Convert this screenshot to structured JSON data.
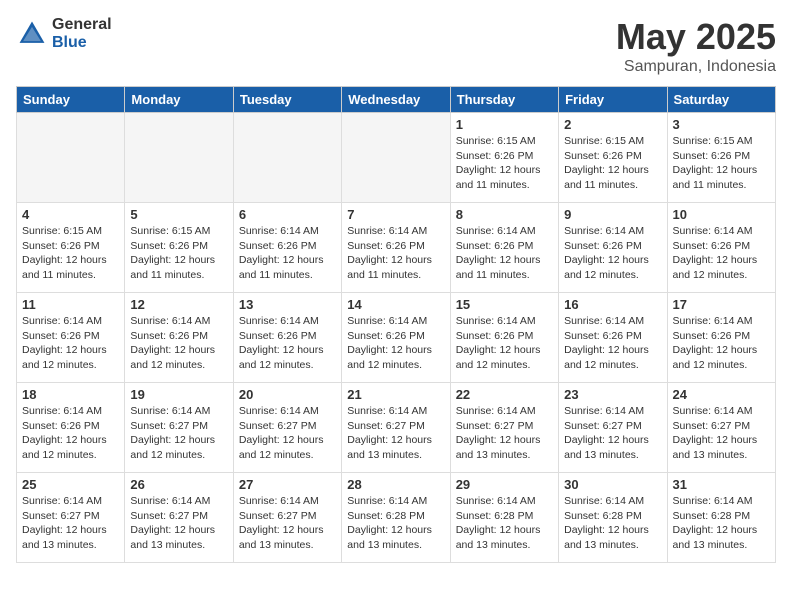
{
  "header": {
    "logo_general": "General",
    "logo_blue": "Blue",
    "title": "May 2025",
    "subtitle": "Sampuran, Indonesia"
  },
  "days_of_week": [
    "Sunday",
    "Monday",
    "Tuesday",
    "Wednesday",
    "Thursday",
    "Friday",
    "Saturday"
  ],
  "weeks": [
    [
      {
        "day": "",
        "info": ""
      },
      {
        "day": "",
        "info": ""
      },
      {
        "day": "",
        "info": ""
      },
      {
        "day": "",
        "info": ""
      },
      {
        "day": "1",
        "info": "Sunrise: 6:15 AM\nSunset: 6:26 PM\nDaylight: 12 hours\nand 11 minutes."
      },
      {
        "day": "2",
        "info": "Sunrise: 6:15 AM\nSunset: 6:26 PM\nDaylight: 12 hours\nand 11 minutes."
      },
      {
        "day": "3",
        "info": "Sunrise: 6:15 AM\nSunset: 6:26 PM\nDaylight: 12 hours\nand 11 minutes."
      }
    ],
    [
      {
        "day": "4",
        "info": "Sunrise: 6:15 AM\nSunset: 6:26 PM\nDaylight: 12 hours\nand 11 minutes."
      },
      {
        "day": "5",
        "info": "Sunrise: 6:15 AM\nSunset: 6:26 PM\nDaylight: 12 hours\nand 11 minutes."
      },
      {
        "day": "6",
        "info": "Sunrise: 6:14 AM\nSunset: 6:26 PM\nDaylight: 12 hours\nand 11 minutes."
      },
      {
        "day": "7",
        "info": "Sunrise: 6:14 AM\nSunset: 6:26 PM\nDaylight: 12 hours\nand 11 minutes."
      },
      {
        "day": "8",
        "info": "Sunrise: 6:14 AM\nSunset: 6:26 PM\nDaylight: 12 hours\nand 11 minutes."
      },
      {
        "day": "9",
        "info": "Sunrise: 6:14 AM\nSunset: 6:26 PM\nDaylight: 12 hours\nand 12 minutes."
      },
      {
        "day": "10",
        "info": "Sunrise: 6:14 AM\nSunset: 6:26 PM\nDaylight: 12 hours\nand 12 minutes."
      }
    ],
    [
      {
        "day": "11",
        "info": "Sunrise: 6:14 AM\nSunset: 6:26 PM\nDaylight: 12 hours\nand 12 minutes."
      },
      {
        "day": "12",
        "info": "Sunrise: 6:14 AM\nSunset: 6:26 PM\nDaylight: 12 hours\nand 12 minutes."
      },
      {
        "day": "13",
        "info": "Sunrise: 6:14 AM\nSunset: 6:26 PM\nDaylight: 12 hours\nand 12 minutes."
      },
      {
        "day": "14",
        "info": "Sunrise: 6:14 AM\nSunset: 6:26 PM\nDaylight: 12 hours\nand 12 minutes."
      },
      {
        "day": "15",
        "info": "Sunrise: 6:14 AM\nSunset: 6:26 PM\nDaylight: 12 hours\nand 12 minutes."
      },
      {
        "day": "16",
        "info": "Sunrise: 6:14 AM\nSunset: 6:26 PM\nDaylight: 12 hours\nand 12 minutes."
      },
      {
        "day": "17",
        "info": "Sunrise: 6:14 AM\nSunset: 6:26 PM\nDaylight: 12 hours\nand 12 minutes."
      }
    ],
    [
      {
        "day": "18",
        "info": "Sunrise: 6:14 AM\nSunset: 6:26 PM\nDaylight: 12 hours\nand 12 minutes."
      },
      {
        "day": "19",
        "info": "Sunrise: 6:14 AM\nSunset: 6:27 PM\nDaylight: 12 hours\nand 12 minutes."
      },
      {
        "day": "20",
        "info": "Sunrise: 6:14 AM\nSunset: 6:27 PM\nDaylight: 12 hours\nand 12 minutes."
      },
      {
        "day": "21",
        "info": "Sunrise: 6:14 AM\nSunset: 6:27 PM\nDaylight: 12 hours\nand 13 minutes."
      },
      {
        "day": "22",
        "info": "Sunrise: 6:14 AM\nSunset: 6:27 PM\nDaylight: 12 hours\nand 13 minutes."
      },
      {
        "day": "23",
        "info": "Sunrise: 6:14 AM\nSunset: 6:27 PM\nDaylight: 12 hours\nand 13 minutes."
      },
      {
        "day": "24",
        "info": "Sunrise: 6:14 AM\nSunset: 6:27 PM\nDaylight: 12 hours\nand 13 minutes."
      }
    ],
    [
      {
        "day": "25",
        "info": "Sunrise: 6:14 AM\nSunset: 6:27 PM\nDaylight: 12 hours\nand 13 minutes."
      },
      {
        "day": "26",
        "info": "Sunrise: 6:14 AM\nSunset: 6:27 PM\nDaylight: 12 hours\nand 13 minutes."
      },
      {
        "day": "27",
        "info": "Sunrise: 6:14 AM\nSunset: 6:27 PM\nDaylight: 12 hours\nand 13 minutes."
      },
      {
        "day": "28",
        "info": "Sunrise: 6:14 AM\nSunset: 6:28 PM\nDaylight: 12 hours\nand 13 minutes."
      },
      {
        "day": "29",
        "info": "Sunrise: 6:14 AM\nSunset: 6:28 PM\nDaylight: 12 hours\nand 13 minutes."
      },
      {
        "day": "30",
        "info": "Sunrise: 6:14 AM\nSunset: 6:28 PM\nDaylight: 12 hours\nand 13 minutes."
      },
      {
        "day": "31",
        "info": "Sunrise: 6:14 AM\nSunset: 6:28 PM\nDaylight: 12 hours\nand 13 minutes."
      }
    ]
  ]
}
